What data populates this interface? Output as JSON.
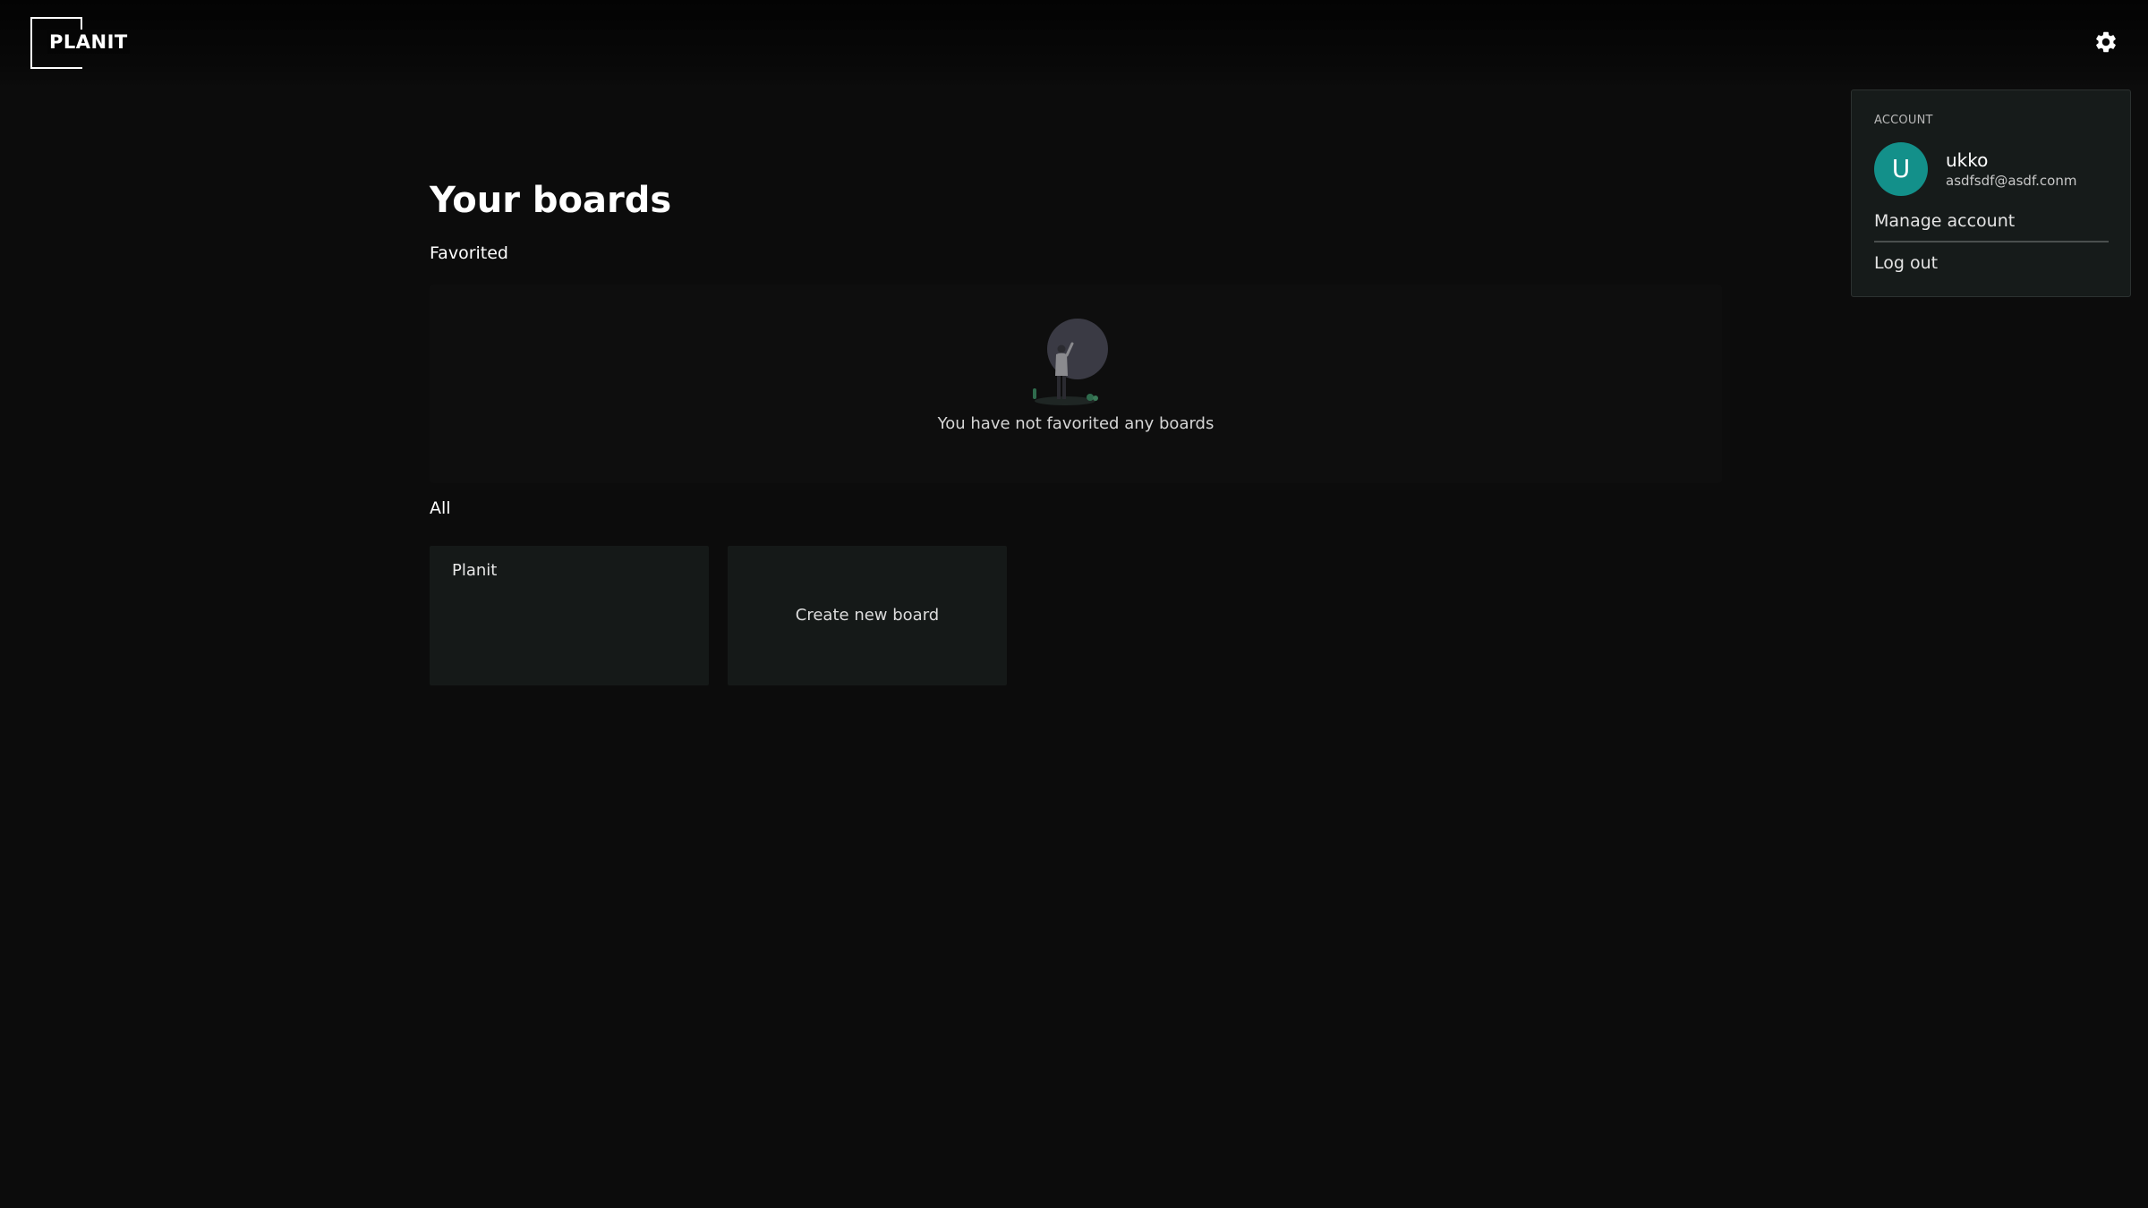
{
  "header": {
    "logo_text": "PLANIT",
    "settings_icon": "gear-icon"
  },
  "main": {
    "title": "Your boards",
    "favorited": {
      "label": "Favorited",
      "empty_message": "You have not favorited any boards",
      "illustration_icon": "empty-favorites-illustration"
    },
    "all": {
      "label": "All",
      "boards": [
        {
          "name": "Planit"
        }
      ],
      "create_label": "Create new board"
    }
  },
  "account_menu": {
    "heading": "ACCOUNT",
    "avatar_initial": "U",
    "username": "ukko",
    "email": "asdfsdf@asdf.conm",
    "items": [
      {
        "label": "Manage account"
      },
      {
        "label": "Log out"
      }
    ]
  },
  "colors": {
    "background": "#0c0c0c",
    "card": "#151918",
    "menu": "#161b1a",
    "avatar": "#13908a"
  }
}
